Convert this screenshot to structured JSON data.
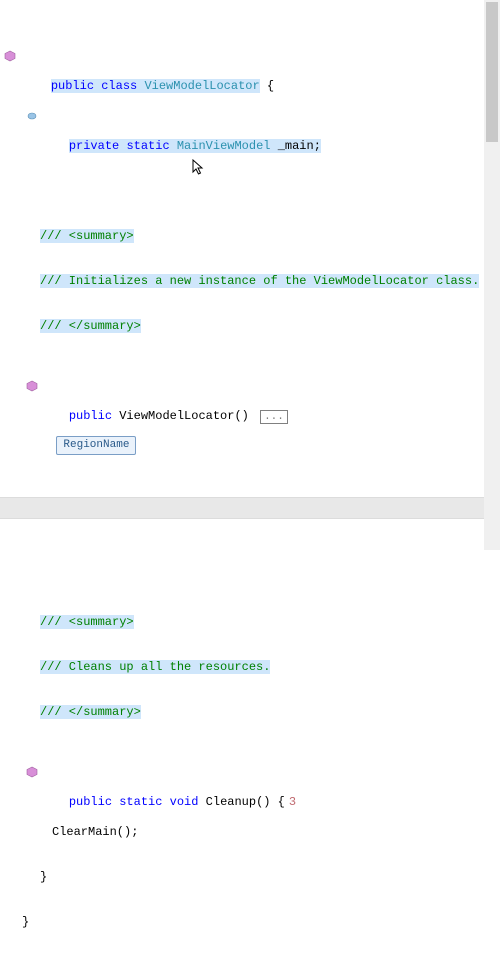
{
  "code": {
    "line1_public": "public",
    "line1_class": "class",
    "line1_type": "ViewModelLocator",
    "line1_brace": " {",
    "line2_private": "private",
    "line2_static": "static",
    "line2_type": "MainViewModel",
    "line2_field": "_main;",
    "summary_open": "/// <summary>",
    "summary_ctor": "/// Initializes a new instance of the ViewModelLocator class.",
    "summary_close": "/// </summary>",
    "ctor_public": "public",
    "ctor_name": "ViewModelLocator()",
    "collapsed": "...",
    "region": "RegionName",
    "summary_cleanup": "/// Cleans up all the resources.",
    "cleanup_public": "public",
    "cleanup_static": "static",
    "cleanup_void": "void",
    "cleanup_name": "Cleanup()",
    "cleanup_brace": " {",
    "cleanup_badge": "3",
    "cleanup_call": "ClearMain();",
    "brace_close": "}",
    "class_close": "}"
  }
}
